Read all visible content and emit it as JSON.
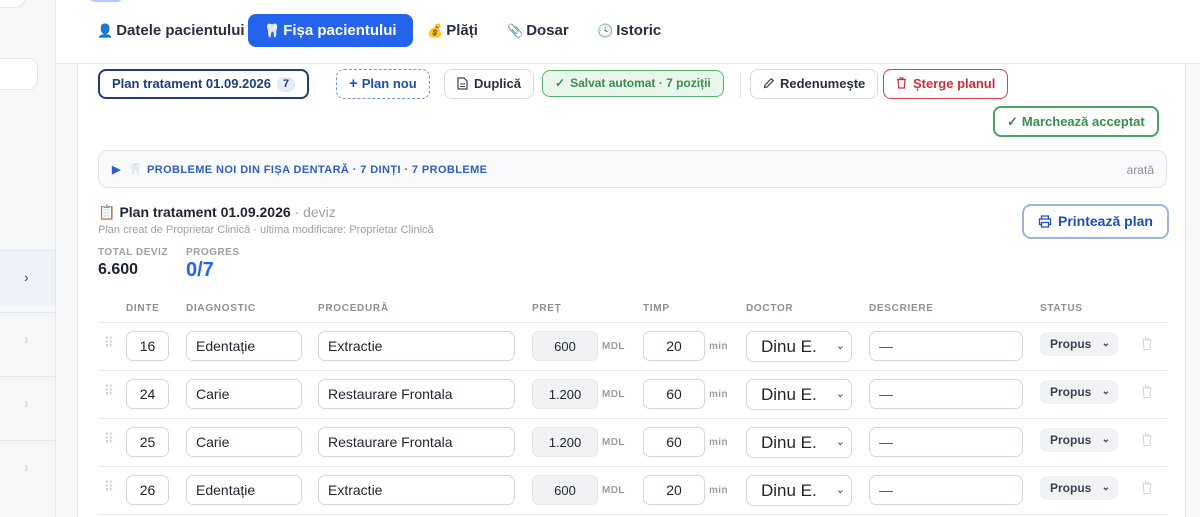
{
  "nav": {
    "tabs": [
      {
        "icon": "👤",
        "label": "Datele pacientului"
      },
      {
        "icon": "🦷",
        "label": "Fișa pacientului"
      },
      {
        "icon": "💰",
        "label": "Plăți"
      },
      {
        "icon": "📎",
        "label": "Dosar"
      },
      {
        "icon": "🕓",
        "label": "Istoric"
      }
    ],
    "active_index": 1
  },
  "toolbar": {
    "plan_label": "Plan tratament 01.09.2026",
    "plan_count": "7",
    "new_plan": "Plan nou",
    "duplicate": "Duplică",
    "saved": "Salvat automat · 7 poziții",
    "rename": "Redenumește",
    "delete": "Șterge planul",
    "accept": "Marchează acceptat"
  },
  "problems": {
    "text": "PROBLEME NOI DIN FIȘA DENTARĂ · 7 DINȚI · 7 PROBLEME",
    "show": "arată"
  },
  "plan": {
    "title": "Plan tratament 01.09.2026",
    "title_suffix": "· deviz",
    "subtitle": "Plan creat de Proprietar Clinică · ultima modificare: Proprietar Clinică",
    "print": "Printează plan",
    "total_label": "TOTAL DEVIZ",
    "total_value": "6.600",
    "progress_label": "PROGRES",
    "progress_value": "0/7"
  },
  "table": {
    "headers": {
      "tooth": "DINTE",
      "diagnosis": "DIAGNOSTIC",
      "procedure": "PROCEDURĂ",
      "price": "PREȚ",
      "time": "TIMP",
      "doctor": "DOCTOR",
      "description": "DESCRIERE",
      "status": "STATUS"
    },
    "price_unit": "MDL",
    "time_unit": "min",
    "rows": [
      {
        "tooth": "16",
        "diagnosis": "Edentație",
        "procedure": "Extractie",
        "price": "600",
        "time": "20",
        "doctor": "Dinu E.",
        "description": "—",
        "status": "Propus"
      },
      {
        "tooth": "24",
        "diagnosis": "Carie",
        "procedure": "Restaurare Frontala",
        "price": "1.200",
        "time": "60",
        "doctor": "Dinu E.",
        "description": "—",
        "status": "Propus"
      },
      {
        "tooth": "25",
        "diagnosis": "Carie",
        "procedure": "Restaurare Frontala",
        "price": "1.200",
        "time": "60",
        "doctor": "Dinu E.",
        "description": "—",
        "status": "Propus"
      },
      {
        "tooth": "26",
        "diagnosis": "Edentație",
        "procedure": "Extractie",
        "price": "600",
        "time": "20",
        "doctor": "Dinu E.",
        "description": "—",
        "status": "Propus"
      }
    ]
  },
  "colors": {
    "accent": "#2463eb",
    "success": "#3b8d4c",
    "danger": "#c8323c"
  }
}
